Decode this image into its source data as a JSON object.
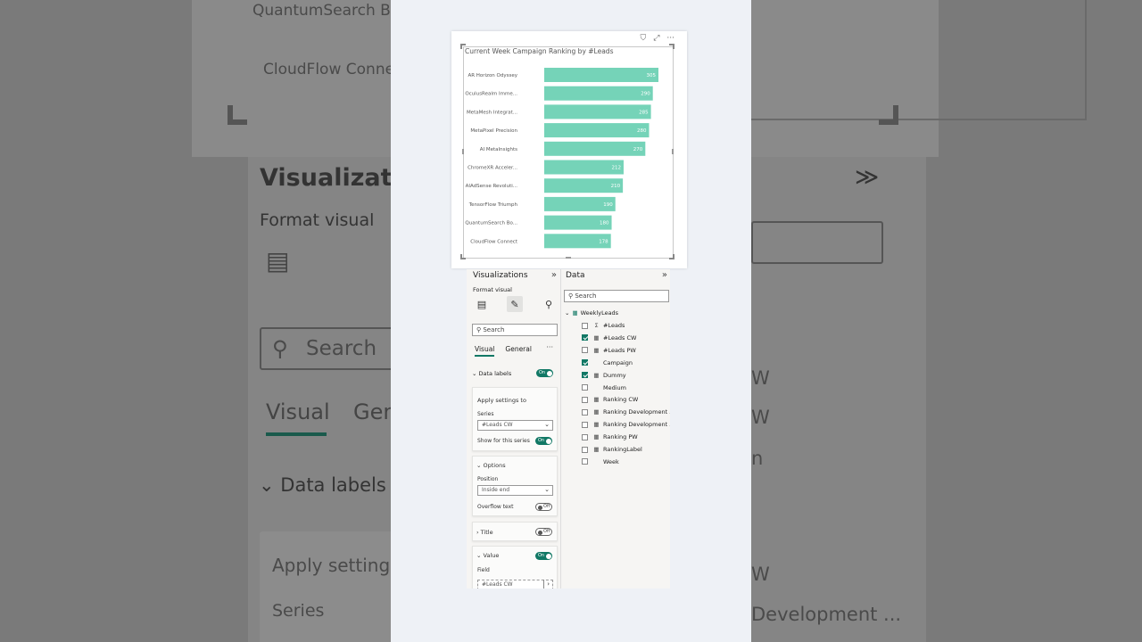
{
  "background": {
    "top_items": [
      "QuantumSearch Bo",
      "CloudFlow Conne"
    ],
    "viz_title": "Visualizatio",
    "format_visual": "Format visual",
    "search": "Search",
    "tab_visual": "Visual",
    "tab_general": "Gen",
    "data_labels": "Data labels",
    "apply_settings": "Apply setting",
    "series": "Series",
    "right_fragments": [
      "W",
      "W",
      "n",
      "W",
      "Development ..."
    ]
  },
  "chart": {
    "title": "Current Week Campaign Ranking by #Leads",
    "toolbar": {
      "filter_icon": "filter-icon",
      "focus_icon": "focus-mode-icon",
      "more_icon": "more-options-icon"
    }
  },
  "chart_data": {
    "type": "bar",
    "orientation": "horizontal",
    "title": "Current Week Campaign Ranking by #Leads",
    "categories": [
      "AR Horizon Odyssey",
      "OculusRealm Imme...",
      "MetaMesh Integrat...",
      "MetaPixel Precision",
      "AI MetaInsights",
      "ChromeXR Acceler...",
      "AIAdSense Revoluti...",
      "TensorFlow Triumph",
      "QuantumSearch Bo...",
      "CloudFlow Connect"
    ],
    "values": [
      305,
      290,
      285,
      280,
      270,
      212,
      210,
      190,
      180,
      178
    ],
    "data_labels": true,
    "color": "#75d3b8",
    "xlim": [
      0,
      305
    ]
  },
  "viz": {
    "title": "Visualizations",
    "collapse_icon": "chevron-right-double-icon",
    "format_label": "Format visual",
    "icons": [
      "format-general-icon",
      "format-visual-icon",
      "analytics-icon"
    ],
    "search_placeholder": "Search",
    "tabs": [
      "Visual",
      "General"
    ],
    "more": "···",
    "data_labels": {
      "label": "Data labels",
      "toggle": "On"
    },
    "apply": {
      "heading": "Apply settings to",
      "series_label": "Series",
      "series_value": "#Leads CW",
      "show_label": "Show for this series",
      "show_toggle": "On"
    },
    "options": {
      "label": "Options",
      "position_label": "Position",
      "position_value": "Inside end",
      "overflow_label": "Overflow text",
      "overflow_toggle": "Off"
    },
    "title_section": {
      "label": "Title",
      "toggle": "Off"
    },
    "value_section": {
      "label": "Value",
      "toggle": "On",
      "field_label": "Field",
      "field_value": "#Leads CW"
    }
  },
  "data": {
    "title": "Data",
    "collapse_icon": "chevron-right-double-icon",
    "search_placeholder": "Search",
    "table": "WeeklyLeads",
    "fields": [
      {
        "name": "#Leads",
        "checked": false,
        "icon": "sigma-icon"
      },
      {
        "name": "#Leads CW",
        "checked": true,
        "icon": "measure-icon"
      },
      {
        "name": "#Leads PW",
        "checked": false,
        "icon": "measure-icon"
      },
      {
        "name": "Campaign",
        "checked": true,
        "icon": ""
      },
      {
        "name": "Dummy",
        "checked": true,
        "icon": "measure-icon"
      },
      {
        "name": "Medium",
        "checked": false,
        "icon": ""
      },
      {
        "name": "Ranking CW",
        "checked": false,
        "icon": "measure-icon"
      },
      {
        "name": "Ranking Development ...",
        "checked": false,
        "icon": "measure-icon"
      },
      {
        "name": "Ranking Development ...",
        "checked": false,
        "icon": "measure-icon"
      },
      {
        "name": "Ranking PW",
        "checked": false,
        "icon": "measure-icon"
      },
      {
        "name": "RankingLabel",
        "checked": false,
        "icon": "measure-icon"
      },
      {
        "name": "Week",
        "checked": false,
        "icon": ""
      }
    ]
  }
}
